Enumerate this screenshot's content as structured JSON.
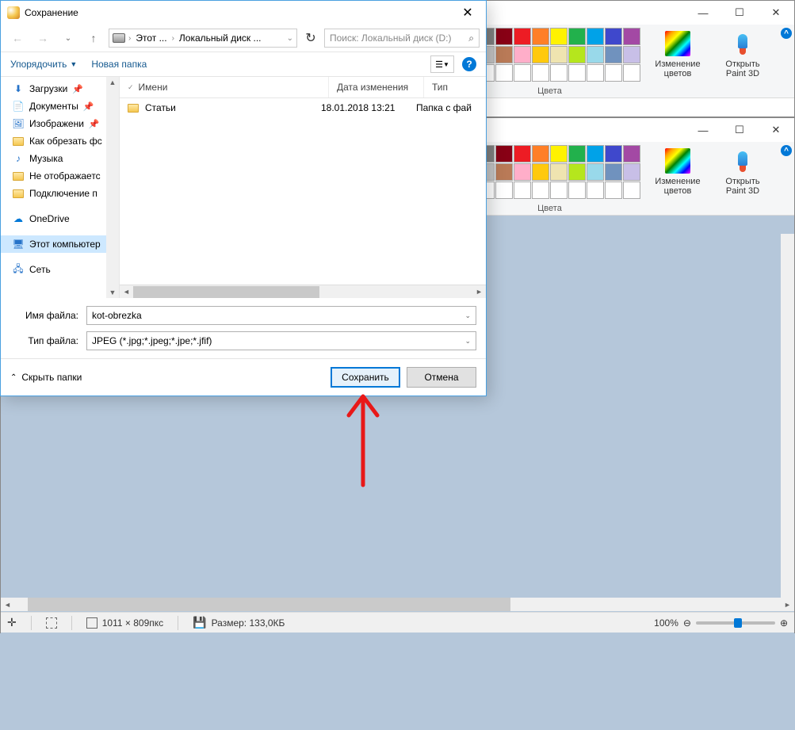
{
  "dialog": {
    "title": "Сохранение",
    "nav": {
      "thisPC": "Этот ...",
      "localDisk": "Локальный диск ...",
      "searchPlaceholder": "Поиск: Локальный диск (D:)"
    },
    "toolbar": {
      "organize": "Упорядочить",
      "newFolder": "Новая папка"
    },
    "sidebar": {
      "downloads": "Загрузки",
      "documents": "Документы",
      "images": "Изображени",
      "howToCrop": "Как обрезать фс",
      "music": "Музыка",
      "notDisplayed": "Не отображаетс",
      "connection": "Подключение п",
      "onedrive": "OneDrive",
      "thisComputer": "Этот компьютер",
      "network": "Сеть"
    },
    "columns": {
      "name": "Имени",
      "dateModified": "Дата изменения",
      "type": "Тип"
    },
    "files": [
      {
        "name": "Статьи",
        "date": "18.01.2018 13:21",
        "type": "Папка с фай"
      }
    ],
    "fields": {
      "filenameLabel": "Имя файла:",
      "filenameValue": "kot-obrezka",
      "filetypeLabel": "Тип файла:",
      "filetypeValue": "JPEG (*.jpg;*.jpeg;*.jpe;*.jfif)"
    },
    "hideFolders": "Скрыть папки",
    "saveBtn": "Сохранить",
    "cancelBtn": "Отмена"
  },
  "ribbon": {
    "colorsLabel": "Цвета",
    "editColors": "Изменение цветов",
    "paint3d": "Открыть Paint 3D",
    "palette": [
      "#000000",
      "#7f7f7f",
      "#880015",
      "#ed1c24",
      "#ff7f27",
      "#fff200",
      "#22b14c",
      "#00a2e8",
      "#3f48cc",
      "#a349a4",
      "#ffffff",
      "#c3c3c3",
      "#b97a57",
      "#ffaec9",
      "#ffc90e",
      "#efe4b0",
      "#b5e61d",
      "#99d9ea",
      "#7092be",
      "#c8bfe7",
      "#ffffff",
      "#ffffff",
      "#ffffff",
      "#ffffff",
      "#ffffff",
      "#ffffff",
      "#ffffff",
      "#ffffff",
      "#ffffff",
      "#ffffff"
    ]
  },
  "statusbar": {
    "dimensions": "1011 × 809пкс",
    "size": "Размер: 133,0КБ",
    "zoom": "100%"
  }
}
